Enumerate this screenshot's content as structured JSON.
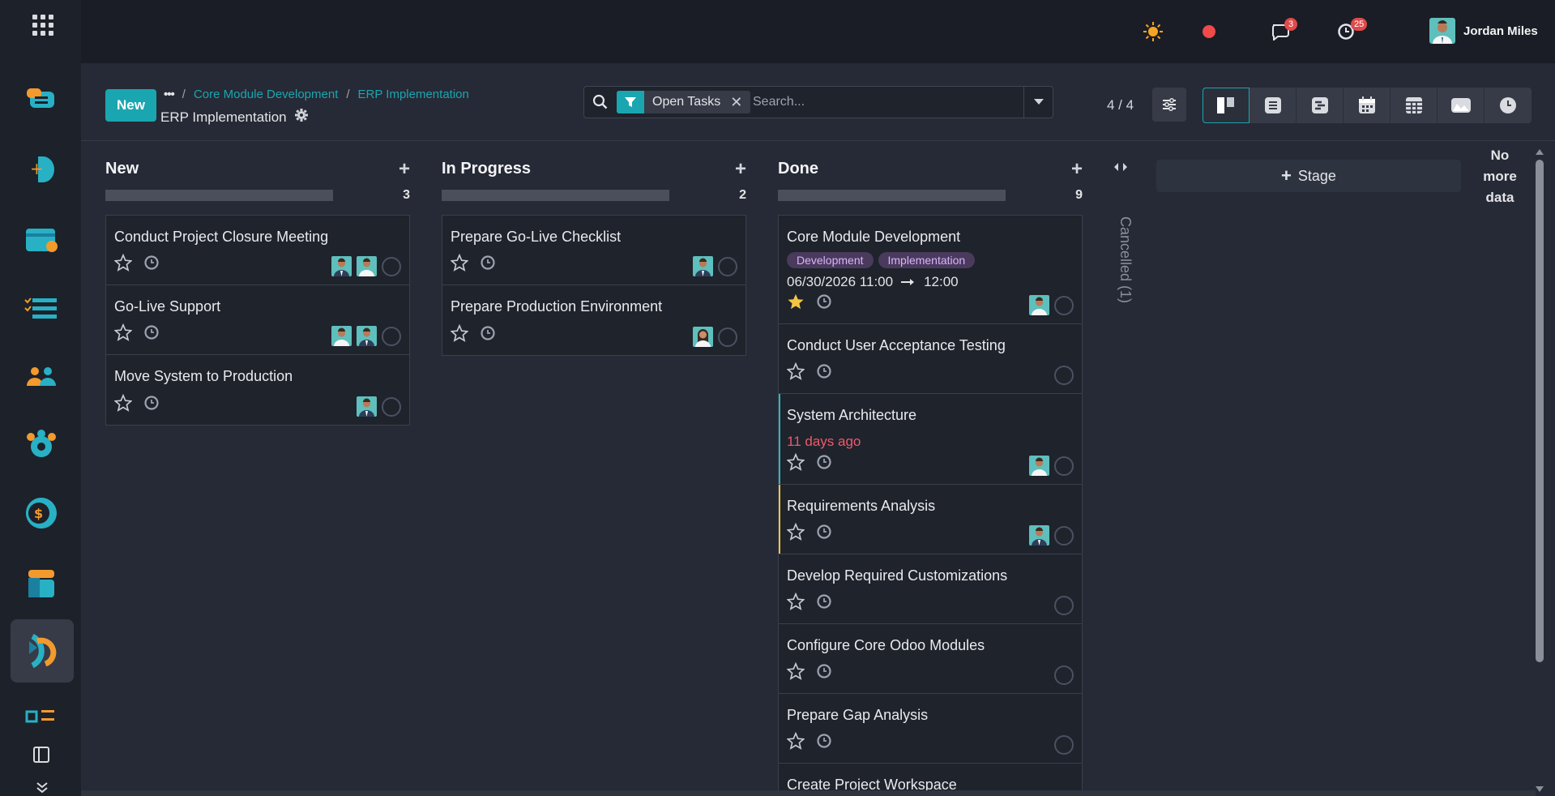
{
  "user": {
    "name": "Jordan Miles"
  },
  "topbar": {
    "chat_badge": "3",
    "activity_badge": "25"
  },
  "control": {
    "new_label": "New",
    "breadcrumb": [
      "Core Module Development",
      "ERP Implementation"
    ],
    "breadcrumb_sep": "/",
    "breadcrumb_more": "•••",
    "page_title": "ERP Implementation",
    "search_facet": "Open Tasks",
    "search_placeholder": "Search...",
    "pager": "4 / 4"
  },
  "columns": {
    "new": {
      "title": "New",
      "count": "3"
    },
    "in_progress": {
      "title": "In Progress",
      "count": "2"
    },
    "done": {
      "title": "Done",
      "count": "9"
    }
  },
  "cards": {
    "new": [
      "Conduct Project Closure Meeting",
      "Go-Live Support",
      "Move System to Production"
    ],
    "in_progress": [
      "Prepare Go-Live Checklist",
      "Prepare Production Environment"
    ],
    "done": {
      "c1": {
        "title": "Core Module Development",
        "tags": [
          "Development",
          "Implementation"
        ],
        "date_start": "06/30/2026 11:00",
        "date_end": "12:00"
      },
      "c2": {
        "title": "Conduct User Acceptance Testing"
      },
      "c3": {
        "title": "System Architecture",
        "overdue": "11 days ago"
      },
      "c4": {
        "title": "Requirements Analysis"
      },
      "c5": {
        "title": "Develop Required Customizations"
      },
      "c6": {
        "title": "Configure Core Odoo Modules"
      },
      "c7": {
        "title": "Prepare Gap Analysis"
      },
      "c8": {
        "title": "Create Project Workspace"
      }
    }
  },
  "folded_stage": "Cancelled (1)",
  "add_stage_label": "Stage",
  "no_more_data": "No more data",
  "colors": {
    "accent": "#1aa6b0",
    "overdue": "#f0596b",
    "tag": "#d8b4fe",
    "star": "#f4c542"
  }
}
